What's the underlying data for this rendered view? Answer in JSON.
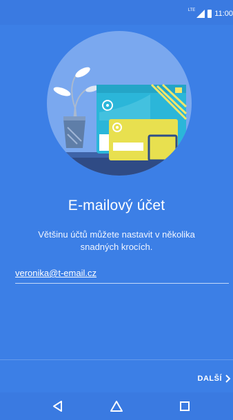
{
  "status_bar": {
    "network": "LTE",
    "time": "11:00"
  },
  "setup": {
    "title": "E-mailový účet",
    "subtitle": "Většinu účtů můžete nastavit v několika snadných krocích.",
    "email_value": "veronika@t-email.cz"
  },
  "footer": {
    "next_label": "DALŠÍ"
  },
  "colors": {
    "background": "#3c7fe6",
    "illustration_circle": "#7aa8ef"
  },
  "icons": {
    "next": "chevron-right-icon",
    "nav_back": "back-triangle-icon",
    "nav_home": "home-icon",
    "nav_recents": "recents-square-icon"
  }
}
